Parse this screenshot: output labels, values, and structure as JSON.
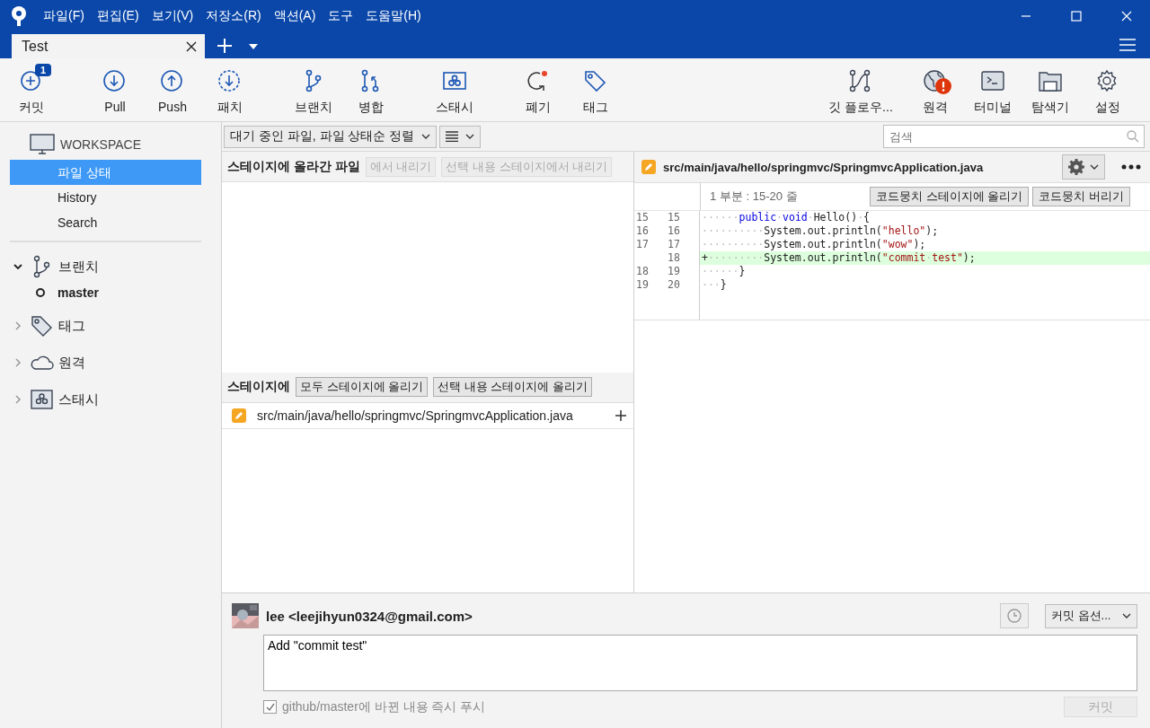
{
  "window": {
    "menu": [
      "파일(F)",
      "편집(E)",
      "보기(V)",
      "저장소(R)",
      "액션(A)",
      "도구",
      "도움말(H)"
    ],
    "tabs": [
      {
        "label": "Test",
        "selected": true
      }
    ]
  },
  "toolbar": {
    "left_groups": [
      {
        "items": [
          {
            "label": "커밋",
            "badge": "1",
            "alert": false
          }
        ]
      },
      {
        "items": [
          {
            "label": "Pull",
            "alert": false
          },
          {
            "label": "Push",
            "alert": false
          },
          {
            "label": "패치",
            "alert": false
          }
        ]
      },
      {
        "items": [
          {
            "label": "브랜치",
            "alert": false
          },
          {
            "label": "병합",
            "alert": false
          }
        ]
      },
      {
        "items": [
          {
            "label": "스태시",
            "alert": false
          }
        ]
      },
      {
        "items": [
          {
            "label": "폐기",
            "alert": false
          },
          {
            "label": "태그",
            "alert": false
          }
        ]
      }
    ],
    "right_groups": [
      {
        "items": [
          {
            "label": "깃 플로우...",
            "alert": false
          }
        ]
      },
      {
        "items": [
          {
            "label": "원격",
            "alert": true
          },
          {
            "label": "터미널",
            "alert": false
          },
          {
            "label": "탐색기",
            "alert": false
          },
          {
            "label": "설정",
            "alert": false
          }
        ]
      }
    ]
  },
  "sidebar": {
    "workspace": {
      "label": "WORKSPACE",
      "items": [
        {
          "label": "파일 상태",
          "selected": true
        },
        {
          "label": "History",
          "selected": false
        },
        {
          "label": "Search",
          "selected": false
        }
      ]
    },
    "sections": [
      {
        "label": "브랜치",
        "expanded": true,
        "children": [
          {
            "label": "master",
            "current": true
          }
        ]
      },
      {
        "label": "태그",
        "expanded": false
      },
      {
        "label": "원격",
        "expanded": false
      },
      {
        "label": "스태시",
        "expanded": false
      }
    ]
  },
  "filter_bar": {
    "sort": "대기 중인 파일, 파일 상태순 정렬",
    "search": {
      "placeholder": "검색"
    }
  },
  "staged": {
    "title": "스테이지에 올라간 파일",
    "buttons": [
      {
        "label": "에서 내리기",
        "disabled": true
      },
      {
        "label": "선택 내용 스테이지에서 내리기",
        "disabled": true
      }
    ]
  },
  "unstaged": {
    "title": "스테이지에",
    "buttons": [
      {
        "label": "모두 스테이지에 올리기",
        "disabled": false
      },
      {
        "label": "선택 내용 스테이지에 올리기",
        "disabled": false
      }
    ],
    "files": [
      {
        "path": "src/main/java/hello/springmvc/SpringmvcApplication.java",
        "color": "#f5a623"
      }
    ]
  },
  "diff": {
    "file": {
      "path": "src/main/java/hello/springmvc/SpringmvcApplication.java",
      "color": "#f5a623"
    },
    "hunk": {
      "title": "1 부분 : 15-20 줄",
      "buttons": [
        "코드뭉치 스테이지에 올리기",
        "코드뭉치 버리기"
      ]
    },
    "lines": [
      {
        "old": "15",
        "new": "15",
        "kind": "context",
        "segments": [
          {
            "text": "······",
            "kind": "space"
          },
          {
            "text": "public",
            "kind": "keyword"
          },
          {
            "text": "·",
            "kind": "space"
          },
          {
            "text": "void",
            "kind": "keyword"
          },
          {
            "text": "·",
            "kind": "space"
          },
          {
            "text": "Hello()",
            "kind": "plain"
          },
          {
            "text": "·",
            "kind": "space"
          },
          {
            "text": "{",
            "kind": "plain"
          }
        ]
      },
      {
        "old": "16",
        "new": "16",
        "kind": "context",
        "segments": [
          {
            "text": "··········",
            "kind": "space"
          },
          {
            "text": "System.out.println(",
            "kind": "plain"
          },
          {
            "text": "\"hello\"",
            "kind": "string"
          },
          {
            "text": ");",
            "kind": "plain"
          }
        ]
      },
      {
        "old": "17",
        "new": "17",
        "kind": "context",
        "segments": [
          {
            "text": "··········",
            "kind": "space"
          },
          {
            "text": "System.out.println(",
            "kind": "plain"
          },
          {
            "text": "\"wow\"",
            "kind": "string"
          },
          {
            "text": ");",
            "kind": "plain"
          }
        ]
      },
      {
        "new": "18",
        "kind": "added",
        "segments": [
          {
            "text": "+",
            "kind": "plain"
          },
          {
            "text": "·········",
            "kind": "space"
          },
          {
            "text": "System.out.println(",
            "kind": "plain"
          },
          {
            "text": "\"commit",
            "kind": "string"
          },
          {
            "text": "·",
            "kind": "space"
          },
          {
            "text": "test\"",
            "kind": "string"
          },
          {
            "text": ");",
            "kind": "plain"
          }
        ]
      },
      {
        "old": "18",
        "new": "19",
        "kind": "context",
        "segments": [
          {
            "text": "······",
            "kind": "space"
          },
          {
            "text": "}",
            "kind": "plain"
          }
        ]
      },
      {
        "old": "19",
        "new": "20",
        "kind": "context",
        "segments": [
          {
            "text": "···",
            "kind": "space"
          },
          {
            "text": "}",
            "kind": "plain"
          }
        ]
      }
    ]
  },
  "commit": {
    "author": "lee  <leejihyun0324@gmail.com>",
    "message": "Add \"commit test\"",
    "options": "커밋 옵션...",
    "push": {
      "label": "github/master에 바뀐 내용 즉시 푸시",
      "checked": true,
      "disabled": true
    },
    "button": {
      "label": "커밋",
      "disabled": true
    }
  }
}
